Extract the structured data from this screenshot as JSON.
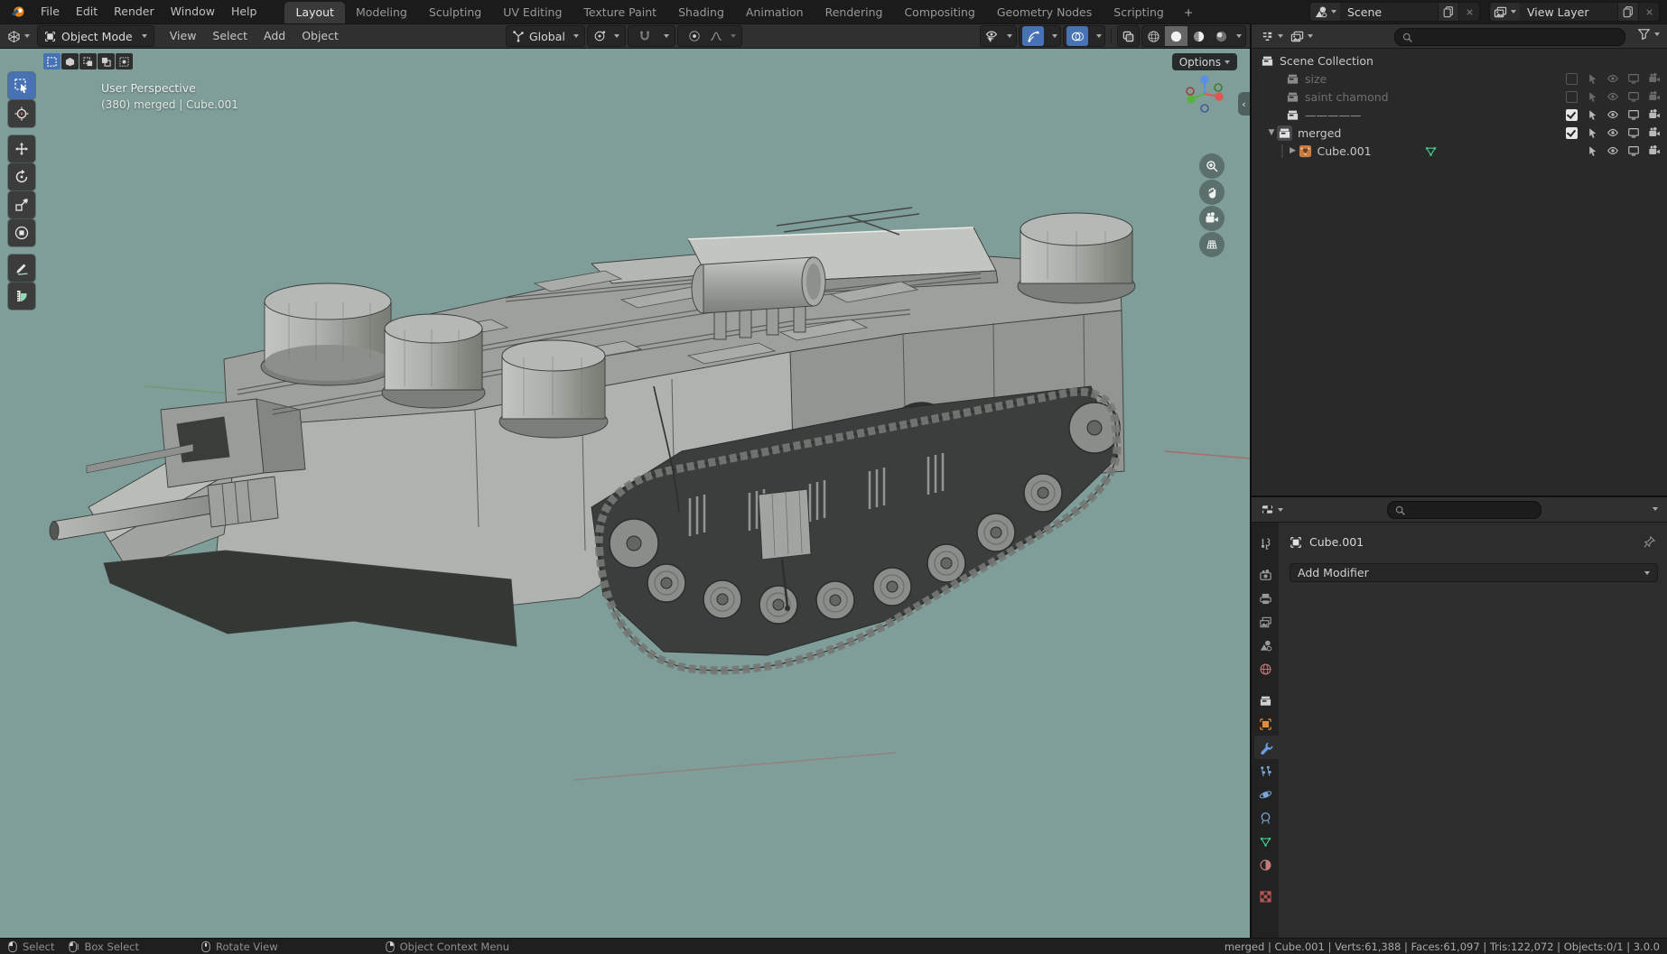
{
  "topbar": {
    "menus": [
      "File",
      "Edit",
      "Render",
      "Window",
      "Help"
    ],
    "tabs": [
      "Layout",
      "Modeling",
      "Sculpting",
      "UV Editing",
      "Texture Paint",
      "Shading",
      "Animation",
      "Rendering",
      "Compositing",
      "Geometry Nodes",
      "Scripting"
    ],
    "active_tab": "Layout",
    "add_tab": "+",
    "scene_name": "Scene",
    "view_layer_name": "View Layer"
  },
  "viewport_header": {
    "mode": "Object Mode",
    "menus": [
      "View",
      "Select",
      "Add",
      "Object"
    ],
    "orientation": "Global"
  },
  "viewport": {
    "projection_label": "User Perspective",
    "selection_label": "(380) merged | Cube.001",
    "options_label": "Options",
    "tools": [
      "select-box",
      "cursor",
      "move",
      "rotate",
      "scale",
      "transform",
      "annotate",
      "measure"
    ],
    "nav_buttons": [
      "zoom",
      "pan-hand",
      "camera-view",
      "orthographic-grid"
    ]
  },
  "outliner": {
    "root_label": "Scene Collection",
    "rows": [
      {
        "label": "size",
        "muted": true,
        "checked": false
      },
      {
        "label": "saint chamond",
        "muted": true,
        "checked": false
      },
      {
        "label": "—————",
        "muted": false,
        "checked": true
      },
      {
        "label": "merged",
        "muted": false,
        "checked": true
      },
      {
        "label": "Cube.001",
        "muted": false
      }
    ]
  },
  "properties": {
    "object_name": "Cube.001",
    "add_modifier_label": "Add Modifier",
    "tabs": [
      "tool",
      "render",
      "output",
      "view-layer",
      "scene",
      "world",
      "collection",
      "object",
      "modifiers",
      "particles",
      "physics",
      "constraints",
      "data",
      "material",
      "texture"
    ],
    "active_tab": "modifiers"
  },
  "statusbar": {
    "hints": [
      {
        "icon": "mouse-left",
        "label": "Select"
      },
      {
        "icon": "mouse-drag",
        "label": "Box Select"
      },
      {
        "icon": "mouse-middle",
        "label": "Rotate View"
      },
      {
        "icon": "mouse-right",
        "label": "Object Context Menu"
      }
    ],
    "stats": "merged | Cube.001 | Verts:61,388 | Faces:61,097 | Tris:122,072 | Objects:0/1 | 3.0.0"
  },
  "colors": {
    "accent": "#4772b3",
    "viewport_bg": "#7f9d99",
    "mesh_orange": "#c97c3f",
    "data_green": "#3fd18f"
  }
}
